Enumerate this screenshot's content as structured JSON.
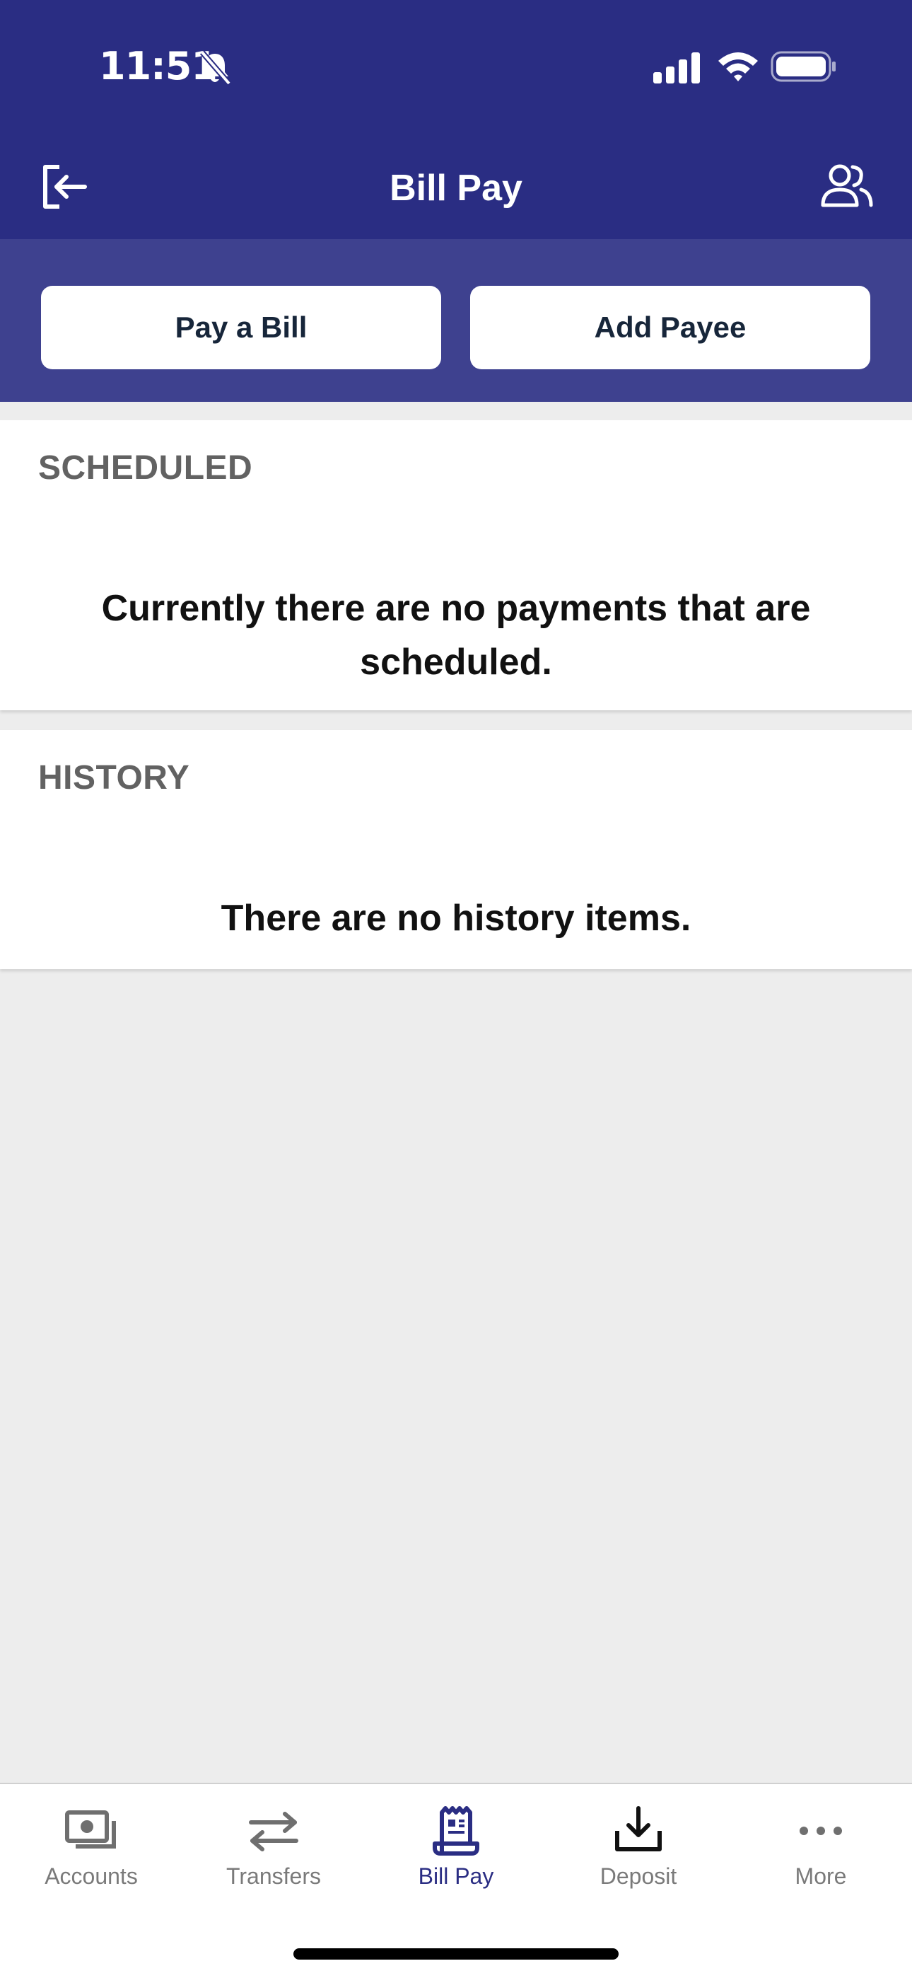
{
  "status_bar": {
    "time": "11:51",
    "icons": [
      "bell-slash-icon",
      "cellular-signal-icon",
      "wifi-icon",
      "battery-icon"
    ]
  },
  "header": {
    "title": "Bill Pay",
    "left_icon": "logout-icon",
    "right_icon": "profile-icon"
  },
  "actions": {
    "pay_bill_label": "Pay a Bill",
    "add_payee_label": "Add Payee"
  },
  "scheduled": {
    "heading": "SCHEDULED",
    "message": "Currently there are no payments that are scheduled."
  },
  "history": {
    "heading": "HISTORY",
    "message": "There are no history items."
  },
  "tabs": [
    {
      "label": "Accounts",
      "icon": "accounts-icon",
      "active": false
    },
    {
      "label": "Transfers",
      "icon": "transfers-icon",
      "active": false
    },
    {
      "label": "Bill Pay",
      "icon": "bill-pay-icon",
      "active": true
    },
    {
      "label": "Deposit",
      "icon": "deposit-icon",
      "active": false
    },
    {
      "label": "More",
      "icon": "more-icon",
      "active": false
    }
  ],
  "colors": {
    "brand": "#2a2d83",
    "action_bar": "#3e418f",
    "background": "#ededed",
    "inactive_tab": "#7a7a7a"
  }
}
